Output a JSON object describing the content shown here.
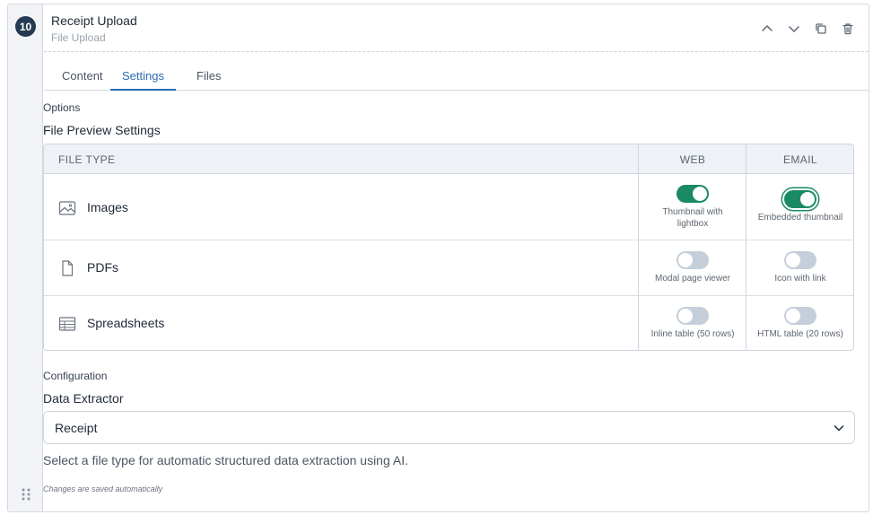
{
  "step": {
    "number": "10"
  },
  "header": {
    "title": "Receipt Upload",
    "subtitle": "File Upload",
    "actions": [
      "chevron-up-icon",
      "chevron-down-icon",
      "copy-icon",
      "trash-icon"
    ]
  },
  "tabs": [
    {
      "label": "Content",
      "active": false
    },
    {
      "label": "Settings",
      "active": true
    },
    {
      "label": "Files",
      "active": false
    }
  ],
  "options": {
    "section_label": "Options",
    "title": "File Preview Settings",
    "table": {
      "headers": {
        "file_type": "FILE TYPE",
        "web": "WEB",
        "email": "EMAIL"
      },
      "rows": [
        {
          "icon": "image-icon",
          "label": "Images",
          "web": {
            "on": true,
            "caption": "Thumbnail with lightbox"
          },
          "email": {
            "on": true,
            "caption": "Embedded thumbnail"
          }
        },
        {
          "icon": "file-icon",
          "label": "PDFs",
          "web": {
            "on": false,
            "caption": "Modal page viewer"
          },
          "email": {
            "on": false,
            "caption": "Icon with link"
          }
        },
        {
          "icon": "table-icon",
          "label": "Spreadsheets",
          "web": {
            "on": false,
            "caption": "Inline table (50 rows)"
          },
          "email": {
            "on": false,
            "caption": "HTML table (20 rows)"
          }
        }
      ]
    }
  },
  "configuration": {
    "section_label": "Configuration",
    "title": "Data Extractor",
    "select_value": "Receipt",
    "help_text": "Select a file type for automatic structured data extraction using AI."
  },
  "footer": {
    "saved_note": "Changes are saved automatically"
  },
  "colors": {
    "accent": "#2b6cb0",
    "toggle_on": "#1a8a63",
    "badge": "#243a52"
  }
}
